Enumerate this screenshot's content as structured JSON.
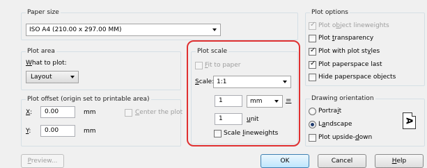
{
  "paper_size": {
    "title": "Paper size",
    "selected": "ISO A4 (210.00 x 297.00 MM)"
  },
  "plot_area": {
    "title": "Plot area",
    "what_prefix": "W",
    "what_rest": "hat to plot:",
    "selected": "Layout"
  },
  "plot_offset": {
    "title": "Plot offset (origin set to printable area)",
    "x_label": "X",
    "x_rest": ":",
    "x_value": "0.00",
    "x_unit": "mm",
    "y_label": "Y",
    "y_rest": ":",
    "y_value": "0.00",
    "y_unit": "mm",
    "center_prefix": "C",
    "center_rest": "enter the plot"
  },
  "plot_scale": {
    "title": "Plot scale",
    "fit_prefix": "F",
    "fit_rest": "it to paper",
    "scale_prefix": "S",
    "scale_rest": "cale:",
    "scale_value": "1:1",
    "value1": "1",
    "unit1": "mm",
    "equals": "=",
    "value2": "1",
    "unit2_prefix": "u",
    "unit2_rest": "nit",
    "lineweights_pre": "Scale ",
    "lineweights_u": "l",
    "lineweights_rest": "ineweights"
  },
  "plot_options": {
    "title": "Plot options",
    "items": [
      {
        "pre": "Plot o",
        "u": "b",
        "rest": "ject lineweights",
        "checked": true,
        "disabled": true
      },
      {
        "pre": "Plot ",
        "u": "t",
        "rest": "ransparency",
        "checked": false,
        "disabled": false
      },
      {
        "pre": "Plot with plot st",
        "u": "y",
        "rest": "les",
        "checked": true,
        "disabled": false
      },
      {
        "pre": "Plot paperspace last",
        "u": "",
        "rest": "",
        "checked": true,
        "disabled": false
      },
      {
        "pre": "Hide paperspace ob",
        "u": "j",
        "rest": "ects",
        "checked": false,
        "disabled": false
      }
    ]
  },
  "drawing_orientation": {
    "title": "Drawing orientation",
    "portrait_pre": "Portra",
    "portrait_u": "i",
    "portrait_rest": "t",
    "landscape_pre": "L",
    "landscape_u": "a",
    "landscape_rest": "ndscape",
    "upside_pre": "Plot upside-",
    "upside_u": "d",
    "upside_rest": "own",
    "icon_glyph": "A",
    "selected": "Landscape"
  },
  "buttons": {
    "preview_pre": "",
    "preview_u": "P",
    "preview_rest": "review...",
    "ok": "OK",
    "cancel": "Cancel",
    "help_u": "H",
    "help_rest": "elp"
  },
  "colors": {
    "highlight_outline": "#e03030",
    "default_button": "#bee6fd"
  },
  "icons": {
    "dropdown": "chevron-down-icon",
    "checkbox_check": "check-icon",
    "orientation": "landscape-page-icon"
  }
}
